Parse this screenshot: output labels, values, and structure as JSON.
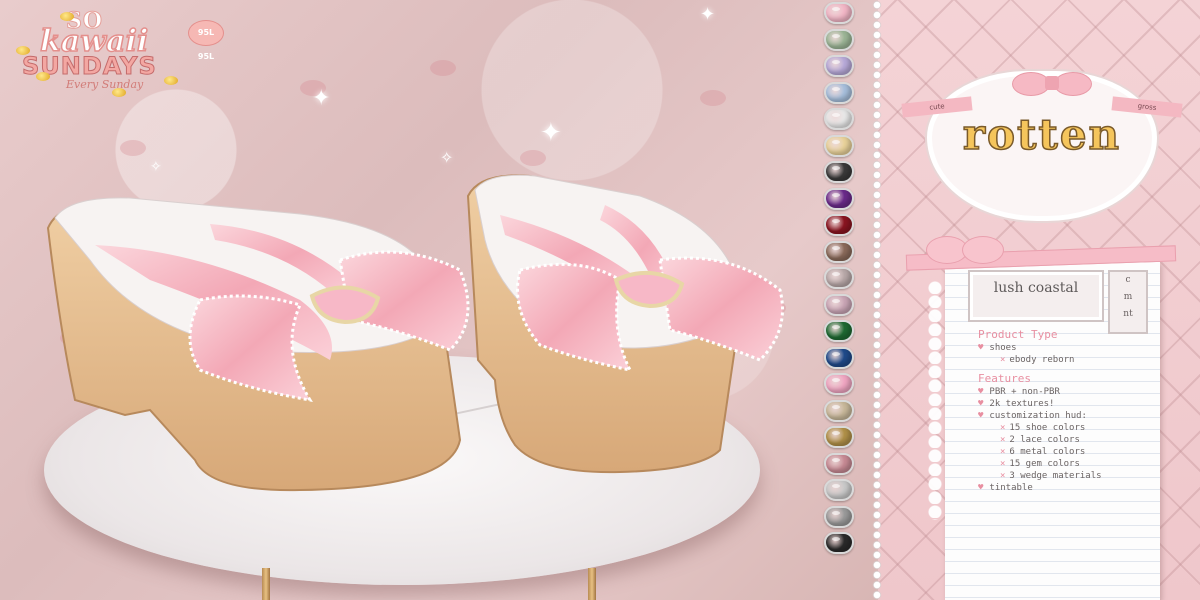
{
  "logo": {
    "line1": "SO",
    "line2": "kawaii",
    "line3": "SUNDAYS",
    "tagline": "Every Sunday",
    "badge": "95L 95L"
  },
  "brand": {
    "name": "rotten",
    "ribbon_left": "cute",
    "ribbon_right": "gross"
  },
  "product": {
    "name": "lush coastal",
    "sizes": [
      "c",
      "m",
      "nt"
    ]
  },
  "info": {
    "product_type_heading": "Product Type",
    "product_type_items": [
      {
        "text": "shoes",
        "level": 0
      },
      {
        "text": "ebody reborn",
        "level": 1
      }
    ],
    "features_heading": "Features",
    "features_items": [
      {
        "text": "PBR + non-PBR",
        "level": 0
      },
      {
        "text": "2k textures!",
        "level": 0
      },
      {
        "text": "customization hud:",
        "level": 0
      },
      {
        "text": "15 shoe colors",
        "level": 1
      },
      {
        "text": "2 lace colors",
        "level": 1
      },
      {
        "text": "6 metal colors",
        "level": 1
      },
      {
        "text": "15 gem colors",
        "level": 1
      },
      {
        "text": "3 wedge materials",
        "level": 1
      },
      {
        "text": "tintable",
        "level": 0
      }
    ]
  },
  "swatch_colors": [
    "#f2b6c6",
    "#9cb596",
    "#b7a9d8",
    "#a7bfdc",
    "#e8e8e8",
    "#e9d29a",
    "#3a3a3a",
    "#6a2a8a",
    "#8a1420",
    "#8a6a5a",
    "#b8a8a8",
    "#c9a5b5",
    "#1e6a32",
    "#1f4a8a",
    "#f0a6c2",
    "#c8b89a",
    "#b09048",
    "#c78a94",
    "#c9c9c9",
    "#9a9a9a",
    "#2a2a2a"
  ]
}
